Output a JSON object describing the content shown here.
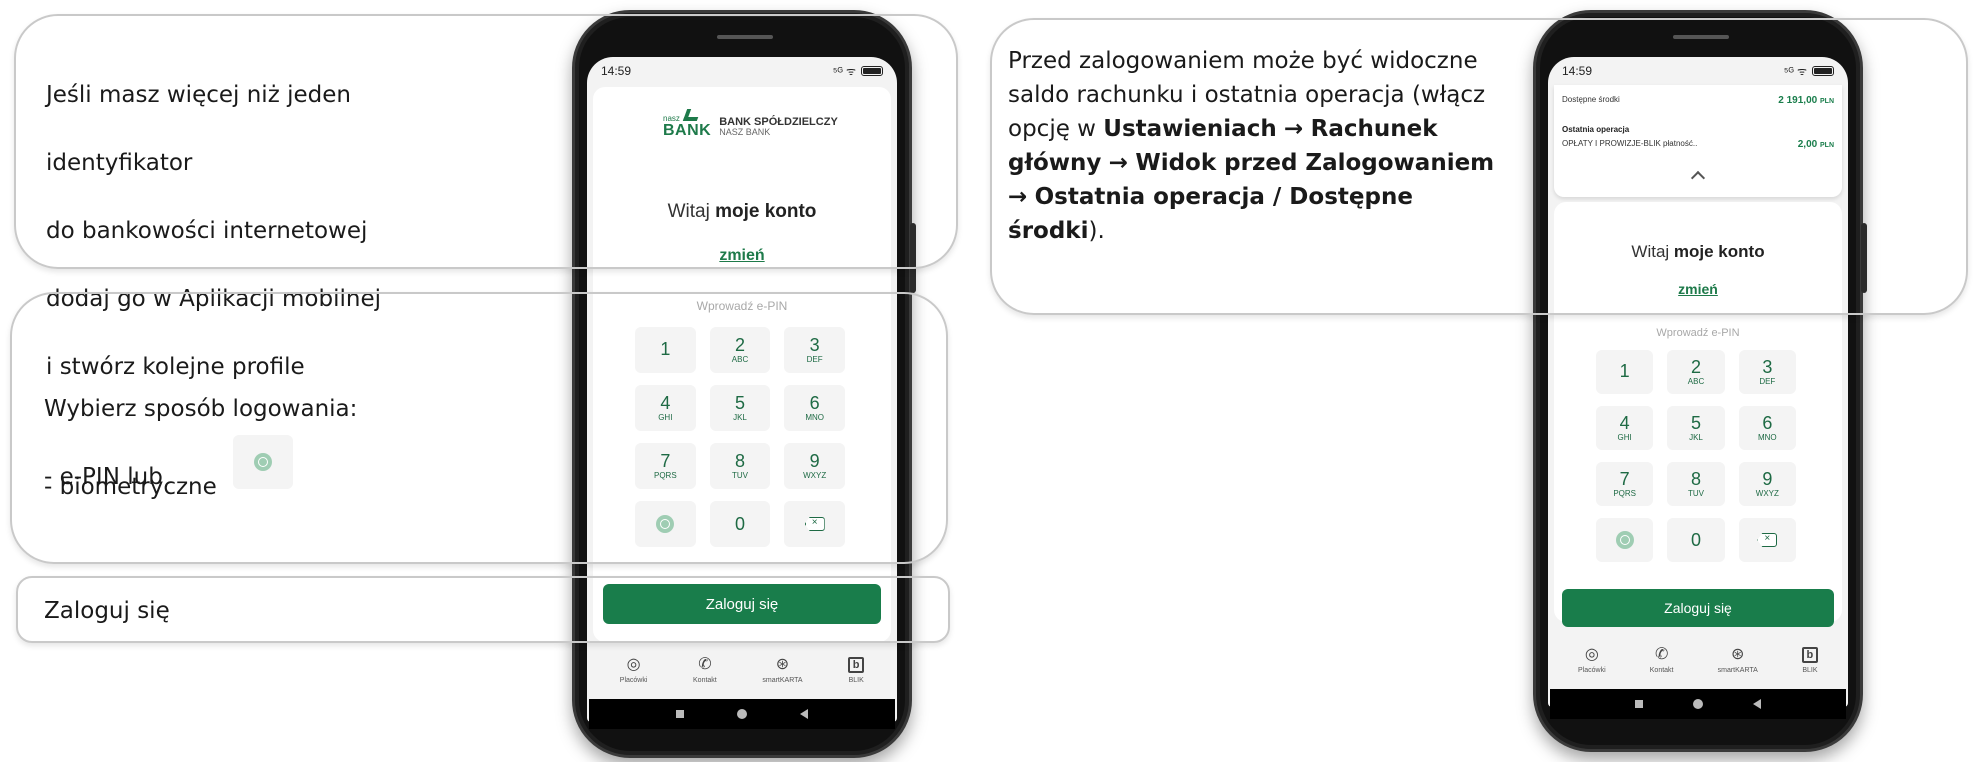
{
  "left_panel": {
    "callout_profiles": {
      "lines": [
        "Jeśli masz więcej niż jeden",
        "identyfikator",
        "do bankowości internetowej",
        "dodaj go w Aplikacji mobilnej",
        "i stwórz kolejne profile"
      ]
    },
    "callout_login_method": {
      "title": "Wybierz sposób logowania:",
      "option_1": "- e-PIN lub",
      "option_2": "- biometryczne",
      "option_2_icon": "fingerprint-icon"
    },
    "callout_login": {
      "text": "Zaloguj się"
    }
  },
  "right_panel": {
    "callout_balance": {
      "part_1": "Przed zalogowaniem może być widoczne saldo rachunku i ostatnia operacja (włącz opcję w ",
      "bold_1": "Ustawieniach",
      "arrow": "→",
      "bold_2": "Rachunek główny",
      "bold_3": "Widok przed Zalogowaniem",
      "bold_4": "Ostatnia operacja / Dostępne środki",
      "part_end": ")."
    }
  },
  "phone": {
    "time": "14:59",
    "status_icons": "⁵ᴳ ᯤ",
    "bank": {
      "logo_small": "nasz",
      "logo_big": "BANK",
      "name_line1": "BANK SPÓŁDZIELCZY",
      "name_line2": "NASZ BANK"
    },
    "welcome_prefix": "Witaj ",
    "welcome_name": "moje konto",
    "change_link": "zmień",
    "pin_placeholder": "Wprowadź e-PIN",
    "keys": [
      {
        "num": "1",
        "sub": ""
      },
      {
        "num": "2",
        "sub": "ABC"
      },
      {
        "num": "3",
        "sub": "DEF"
      },
      {
        "num": "4",
        "sub": "GHI"
      },
      {
        "num": "5",
        "sub": "JKL"
      },
      {
        "num": "6",
        "sub": "MNO"
      },
      {
        "num": "7",
        "sub": "PQRS"
      },
      {
        "num": "8",
        "sub": "TUV"
      },
      {
        "num": "9",
        "sub": "WXYZ"
      }
    ],
    "zero_key": "0",
    "login_button": "Zaloguj się",
    "nav": [
      {
        "label": "Placówki",
        "icon": "location-pin-icon",
        "glyph": "◎"
      },
      {
        "label": "Kontakt",
        "icon": "phone-icon",
        "glyph": "✆"
      },
      {
        "label": "smartKARTA",
        "icon": "smartkarta-icon",
        "glyph": "⊛"
      },
      {
        "label": "BLIK",
        "icon": "blik-icon",
        "glyph": "b"
      }
    ],
    "balance": {
      "available_label": "Dostępne środki",
      "available_value": "2 191,00",
      "currency": "PLN",
      "last_op_heading": "Ostatnia operacja",
      "last_op_desc": "OPŁATY I PROWIZJE-BLIK płatność..",
      "last_op_value": "2,00",
      "last_op_currency": "PLN"
    }
  },
  "colors": {
    "brand_green": "#197d4b",
    "callout_border": "#c9c9c9",
    "text": "#1a1a1a"
  }
}
